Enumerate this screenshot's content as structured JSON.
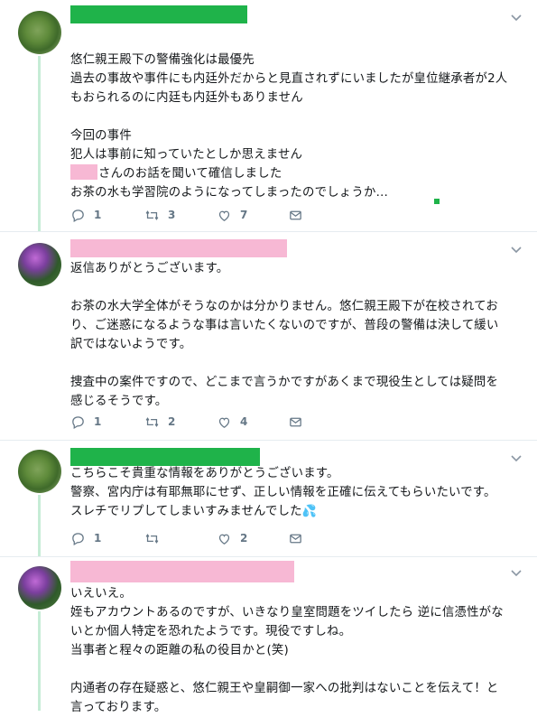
{
  "tweets": [
    {
      "lines": [
        "悠仁親王殿下の警備強化は最優先",
        "過去の事故や事件にも内廷外だからと見直されずにいましたが皇位継承者が2人",
        "もおられるのに内廷も内廷外もありません",
        "",
        "今回の事件",
        "犯人は事前に知っていたとしか思えません",
        "さんのお話を聞いて確信しました",
        "お茶の水も学習院のようになってしまったのでしょうか…"
      ],
      "reply_count": "1",
      "retweet_count": "3",
      "like_count": "7"
    },
    {
      "lines": [
        "返信ありがとうございます。",
        "",
        "お茶の水大学全体がそうなのかは分かりません。悠仁親王殿下が在校されてお",
        "り、ご迷惑になるような事は言いたくないのですが、普段の警備は決して緩い",
        "訳ではないようです。",
        "",
        "捜査中の案件ですので、どこまで言うかですがあくまで現役生としては疑問を",
        "感じるそうです。"
      ],
      "reply_count": "1",
      "retweet_count": "2",
      "like_count": "4"
    },
    {
      "lines": [
        "こちらこそ貴重な情報をありがとうございます。",
        "警察、宮内庁は有耶無耶にせず、正しい情報を正確に伝えてもらいたいです。",
        "スレチでリプしてしまいすみませんでした"
      ],
      "reply_count": "1",
      "retweet_count": "",
      "like_count": "2"
    },
    {
      "lines": [
        "いえいえ。",
        "姪もアカウントあるのですが、いきなり皇室問題をツイしたら 逆に信憑性がな",
        "いとか個人特定を恐れたようです。現役ですしね。",
        "当事者と程々の距離の私の役目かと(笑)",
        "",
        "内通者の存在疑惑と、悠仁親王や皇嗣御一家への批判はないことを伝えて！と",
        "言っております。"
      ]
    }
  ],
  "icons": [
    "reply-icon",
    "retweet-icon",
    "like-icon",
    "dm-icon",
    "chevron-down-icon"
  ],
  "colors": {
    "redact_green": "#1fb34a",
    "redact_pink": "#f7b8d4",
    "thread_line": "#c6ecd6",
    "action_gray": "#657786"
  }
}
